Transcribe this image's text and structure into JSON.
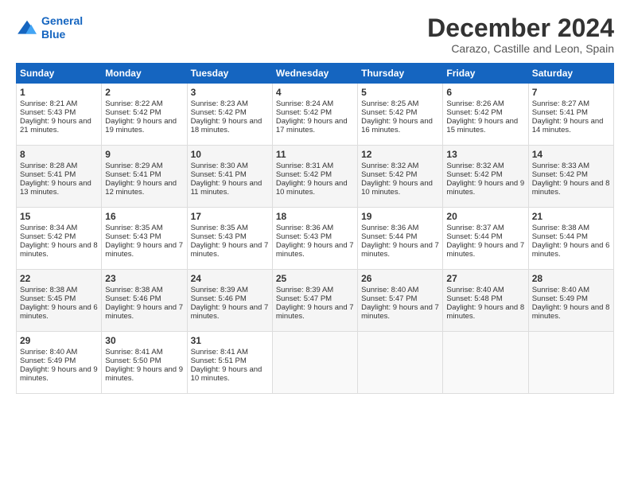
{
  "logo": {
    "line1": "General",
    "line2": "Blue"
  },
  "title": "December 2024",
  "subtitle": "Carazo, Castille and Leon, Spain",
  "headers": [
    "Sunday",
    "Monday",
    "Tuesday",
    "Wednesday",
    "Thursday",
    "Friday",
    "Saturday"
  ],
  "weeks": [
    [
      {
        "day": "1",
        "sunrise": "8:21 AM",
        "sunset": "5:43 PM",
        "daylight": "9 hours and 21 minutes."
      },
      {
        "day": "2",
        "sunrise": "8:22 AM",
        "sunset": "5:42 PM",
        "daylight": "9 hours and 19 minutes."
      },
      {
        "day": "3",
        "sunrise": "8:23 AM",
        "sunset": "5:42 PM",
        "daylight": "9 hours and 18 minutes."
      },
      {
        "day": "4",
        "sunrise": "8:24 AM",
        "sunset": "5:42 PM",
        "daylight": "9 hours and 17 minutes."
      },
      {
        "day": "5",
        "sunrise": "8:25 AM",
        "sunset": "5:42 PM",
        "daylight": "9 hours and 16 minutes."
      },
      {
        "day": "6",
        "sunrise": "8:26 AM",
        "sunset": "5:42 PM",
        "daylight": "9 hours and 15 minutes."
      },
      {
        "day": "7",
        "sunrise": "8:27 AM",
        "sunset": "5:41 PM",
        "daylight": "9 hours and 14 minutes."
      }
    ],
    [
      {
        "day": "8",
        "sunrise": "8:28 AM",
        "sunset": "5:41 PM",
        "daylight": "9 hours and 13 minutes."
      },
      {
        "day": "9",
        "sunrise": "8:29 AM",
        "sunset": "5:41 PM",
        "daylight": "9 hours and 12 minutes."
      },
      {
        "day": "10",
        "sunrise": "8:30 AM",
        "sunset": "5:41 PM",
        "daylight": "9 hours and 11 minutes."
      },
      {
        "day": "11",
        "sunrise": "8:31 AM",
        "sunset": "5:42 PM",
        "daylight": "9 hours and 10 minutes."
      },
      {
        "day": "12",
        "sunrise": "8:32 AM",
        "sunset": "5:42 PM",
        "daylight": "9 hours and 10 minutes."
      },
      {
        "day": "13",
        "sunrise": "8:32 AM",
        "sunset": "5:42 PM",
        "daylight": "9 hours and 9 minutes."
      },
      {
        "day": "14",
        "sunrise": "8:33 AM",
        "sunset": "5:42 PM",
        "daylight": "9 hours and 8 minutes."
      }
    ],
    [
      {
        "day": "15",
        "sunrise": "8:34 AM",
        "sunset": "5:42 PM",
        "daylight": "9 hours and 8 minutes."
      },
      {
        "day": "16",
        "sunrise": "8:35 AM",
        "sunset": "5:43 PM",
        "daylight": "9 hours and 7 minutes."
      },
      {
        "day": "17",
        "sunrise": "8:35 AM",
        "sunset": "5:43 PM",
        "daylight": "9 hours and 7 minutes."
      },
      {
        "day": "18",
        "sunrise": "8:36 AM",
        "sunset": "5:43 PM",
        "daylight": "9 hours and 7 minutes."
      },
      {
        "day": "19",
        "sunrise": "8:36 AM",
        "sunset": "5:44 PM",
        "daylight": "9 hours and 7 minutes."
      },
      {
        "day": "20",
        "sunrise": "8:37 AM",
        "sunset": "5:44 PM",
        "daylight": "9 hours and 7 minutes."
      },
      {
        "day": "21",
        "sunrise": "8:38 AM",
        "sunset": "5:44 PM",
        "daylight": "9 hours and 6 minutes."
      }
    ],
    [
      {
        "day": "22",
        "sunrise": "8:38 AM",
        "sunset": "5:45 PM",
        "daylight": "9 hours and 6 minutes."
      },
      {
        "day": "23",
        "sunrise": "8:38 AM",
        "sunset": "5:46 PM",
        "daylight": "9 hours and 7 minutes."
      },
      {
        "day": "24",
        "sunrise": "8:39 AM",
        "sunset": "5:46 PM",
        "daylight": "9 hours and 7 minutes."
      },
      {
        "day": "25",
        "sunrise": "8:39 AM",
        "sunset": "5:47 PM",
        "daylight": "9 hours and 7 minutes."
      },
      {
        "day": "26",
        "sunrise": "8:40 AM",
        "sunset": "5:47 PM",
        "daylight": "9 hours and 7 minutes."
      },
      {
        "day": "27",
        "sunrise": "8:40 AM",
        "sunset": "5:48 PM",
        "daylight": "9 hours and 8 minutes."
      },
      {
        "day": "28",
        "sunrise": "8:40 AM",
        "sunset": "5:49 PM",
        "daylight": "9 hours and 8 minutes."
      }
    ],
    [
      {
        "day": "29",
        "sunrise": "8:40 AM",
        "sunset": "5:49 PM",
        "daylight": "9 hours and 9 minutes."
      },
      {
        "day": "30",
        "sunrise": "8:41 AM",
        "sunset": "5:50 PM",
        "daylight": "9 hours and 9 minutes."
      },
      {
        "day": "31",
        "sunrise": "8:41 AM",
        "sunset": "5:51 PM",
        "daylight": "9 hours and 10 minutes."
      },
      null,
      null,
      null,
      null
    ]
  ],
  "labels": {
    "sunrise": "Sunrise:",
    "sunset": "Sunset:",
    "daylight": "Daylight:"
  }
}
